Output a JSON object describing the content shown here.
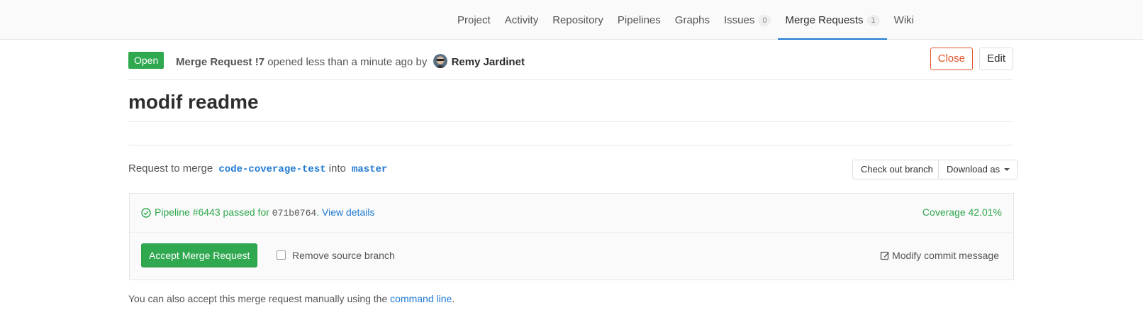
{
  "nav": {
    "tabs": [
      {
        "label": "Project"
      },
      {
        "label": "Activity"
      },
      {
        "label": "Repository"
      },
      {
        "label": "Pipelines"
      },
      {
        "label": "Graphs"
      },
      {
        "label": "Issues",
        "count": "0"
      },
      {
        "label": "Merge Requests",
        "count": "1",
        "active": true
      },
      {
        "label": "Wiki"
      }
    ]
  },
  "header": {
    "status": "Open",
    "mr_ref": "Merge Request !7",
    "opened_text": "opened less than a minute ago by",
    "author": "Remy Jardinet",
    "close_label": "Close",
    "edit_label": "Edit"
  },
  "title": "modif readme",
  "merge": {
    "prefix": "Request to merge",
    "source_branch": "code-coverage-test",
    "into": "into",
    "target_branch": "master",
    "checkout_label": "Check out branch",
    "download_label": "Download as"
  },
  "widget": {
    "pipeline_prefix": "Pipeline #6443 passed for",
    "commit": "071b0764",
    "dot": ".",
    "view_details": "View details",
    "coverage": "Coverage 42.01%",
    "accept_label": "Accept Merge Request",
    "remove_source_label": "Remove source branch",
    "modify_commit_label": "Modify commit message"
  },
  "manual": {
    "text": "You can also accept this merge request manually using the",
    "link": "command line",
    "end": "."
  },
  "colors": {
    "green": "#2fa84f",
    "link": "#1f78d1",
    "danger": "#e4542b"
  }
}
